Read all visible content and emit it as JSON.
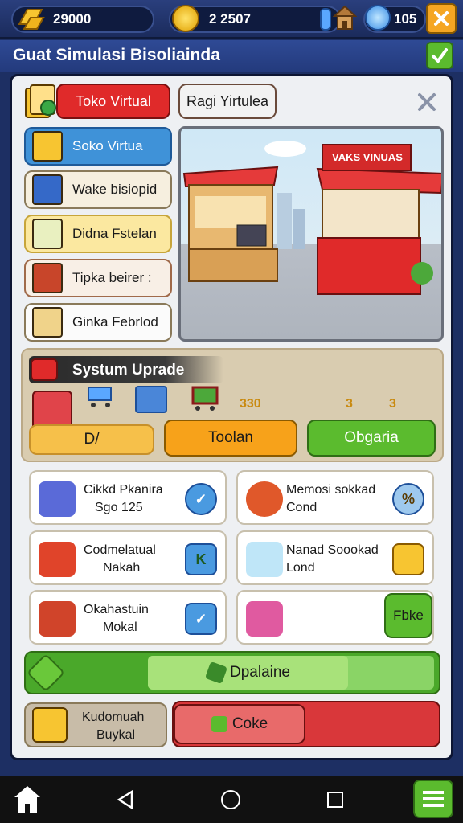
{
  "topbar": {
    "gold": "29000",
    "coins": "2 2507",
    "gems": "105"
  },
  "title": "Guat Simulasi Bisoliainda",
  "tabs": {
    "active": "Toko Virtual",
    "inactive": "Ragi Yirtulea"
  },
  "sidebar": [
    {
      "label": "Soko Virtua"
    },
    {
      "label": "Wake bisiopid"
    },
    {
      "label": "Didna Fstelan"
    },
    {
      "label": "Tipka beirer :"
    },
    {
      "label": "Ginka Febrlod"
    }
  ],
  "scene": {
    "shop_sign": "VAKS VINUAS"
  },
  "upgrade": {
    "title": "Systum Uprade",
    "level_label": "D/",
    "cost_a": "330",
    "cost_b": "3",
    "cost_c": "3",
    "button_orange": "Toolan",
    "button_green": "Obgaria"
  },
  "cards": [
    {
      "line1": "Cikkd Pkanira",
      "line2": "Sgo 125",
      "badge": "check"
    },
    {
      "line1": "Memosi sokkad",
      "line2": "Cond",
      "badge": "percent"
    },
    {
      "line1": "Codmelatual",
      "line2": "Nakah",
      "badge": "K"
    },
    {
      "line1": "Nanad Soookad",
      "line2": "Lond",
      "badge": "box"
    },
    {
      "line1": "Okahastuin",
      "line2": "Mokal",
      "badge": "check"
    },
    {
      "line1": "",
      "line2": "",
      "badge": "Fbke"
    }
  ],
  "progress": {
    "label": "Dpalaine",
    "fill_percent": 70
  },
  "footer": {
    "left_line1": "Kudomuah",
    "left_line2": "Buykal",
    "red_button": "Coke"
  },
  "colors": {
    "tab_active": "#e02a2a",
    "sidebar_active": "#3f92d8",
    "orange": "#f7a21a",
    "green": "#5bbb2e",
    "red": "#d9373a"
  }
}
